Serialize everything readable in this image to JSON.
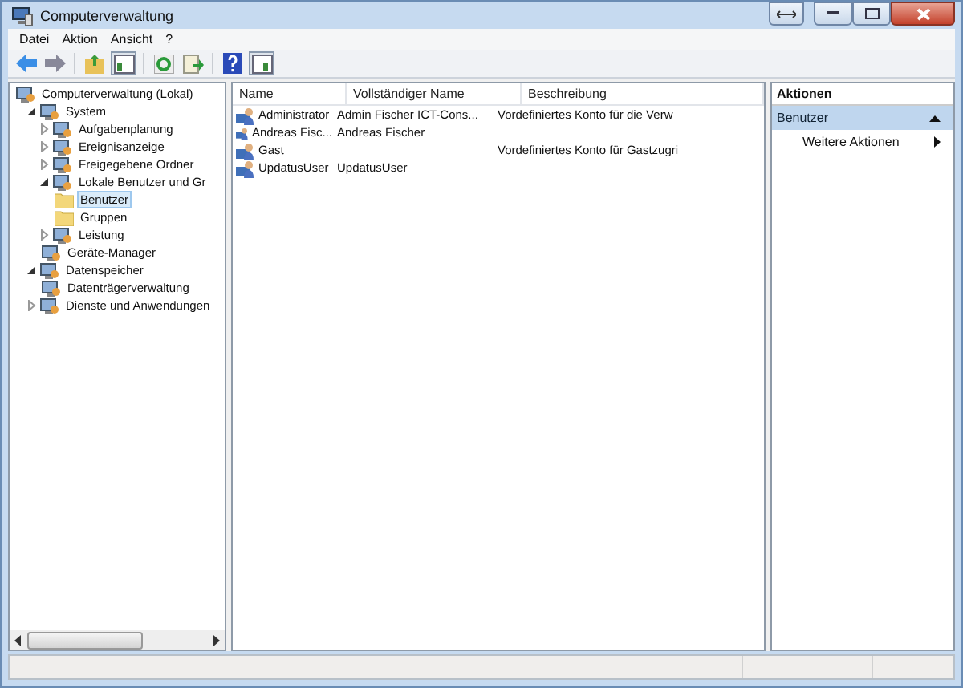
{
  "window": {
    "title": "Computerverwaltung"
  },
  "menu": [
    "Datei",
    "Aktion",
    "Ansicht",
    "?"
  ],
  "tree": [
    {
      "label": "Computerverwaltung (Lokal)",
      "kind": "leaf",
      "selected": false,
      "children": [
        {
          "label": "System",
          "kind": "node",
          "expanded": true,
          "selected": false,
          "children": [
            {
              "label": "Aufgabenplanung",
              "kind": "node",
              "expanded": false,
              "selected": false
            },
            {
              "label": "Ereignisanzeige",
              "kind": "node",
              "expanded": false,
              "selected": false
            },
            {
              "label": "Freigegebene Ordner",
              "kind": "node",
              "expanded": false,
              "selected": false
            },
            {
              "label": "Lokale Benutzer und Gr",
              "kind": "node",
              "expanded": true,
              "selected": false,
              "children": [
                {
                  "label": "Benutzer",
                  "kind": "leaf",
                  "selected": true
                },
                {
                  "label": "Gruppen",
                  "kind": "leaf",
                  "selected": false
                }
              ]
            },
            {
              "label": "Leistung",
              "kind": "node",
              "expanded": false,
              "selected": false
            },
            {
              "label": "Geräte-Manager",
              "kind": "leaf",
              "selected": false
            }
          ]
        },
        {
          "label": "Datenspeicher",
          "kind": "node",
          "expanded": true,
          "selected": false,
          "children": [
            {
              "label": "Datenträgerverwaltung",
              "kind": "leaf",
              "selected": false
            }
          ]
        },
        {
          "label": "Dienste und Anwendungen",
          "kind": "node",
          "expanded": false,
          "selected": false
        }
      ]
    }
  ],
  "table": {
    "columns": [
      "Name",
      "Vollständiger Name",
      "Beschreibung"
    ],
    "rows": [
      {
        "name": "Administrator",
        "full_name": "Admin Fischer ICT-Cons...",
        "description": "Vordefiniertes Konto für die Verw"
      },
      {
        "name": "Andreas Fisc...",
        "full_name": "Andreas Fischer",
        "description": ""
      },
      {
        "name": "Gast",
        "full_name": "",
        "description": "Vordefiniertes Konto für Gastzugri"
      },
      {
        "name": "UpdatusUser",
        "full_name": "UpdatusUser",
        "description": ""
      }
    ]
  },
  "actions": {
    "title": "Aktionen",
    "section": "Benutzer",
    "items": [
      "Weitere Aktionen"
    ]
  }
}
